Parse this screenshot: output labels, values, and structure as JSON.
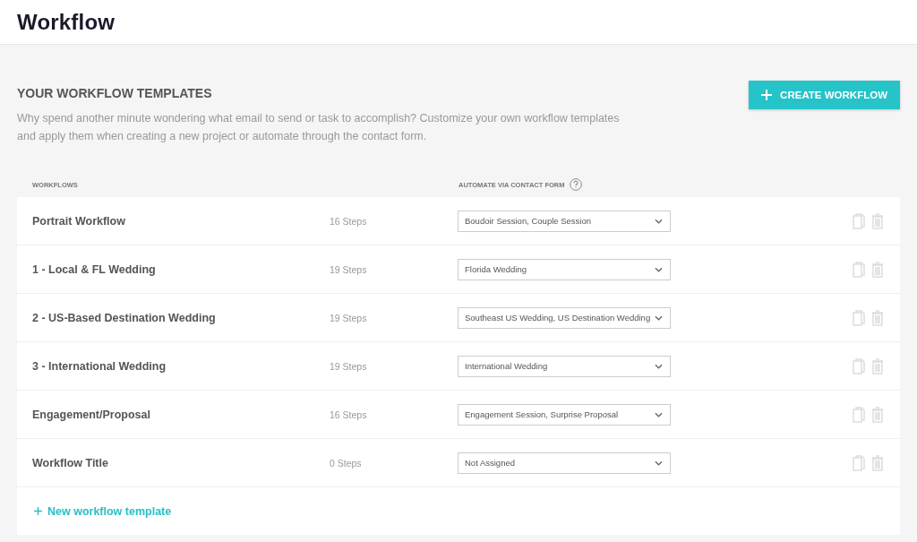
{
  "page_title": "Workflow",
  "section": {
    "heading": "YOUR WORKFLOW TEMPLATES",
    "description": "Why spend another minute wondering what email to send or task to accomplish? Customize your own workflow templates and apply them when creating a new project or automate through the contact form.",
    "create_button": "CREATE WORKFLOW"
  },
  "table": {
    "columns": [
      "WORKFLOWS",
      "AUTOMATE VIA CONTACT FORM"
    ],
    "rows": [
      {
        "name": "Portrait Workflow",
        "steps": "16 Steps",
        "contact_form": "Boudoir Session, Couple Session"
      },
      {
        "name": "1 - Local & FL Wedding",
        "steps": "19 Steps",
        "contact_form": "Florida Wedding"
      },
      {
        "name": "2 - US-Based Destination Wedding",
        "steps": "19 Steps",
        "contact_form": "Southeast US Wedding, US Destination Wedding"
      },
      {
        "name": "3 - International Wedding",
        "steps": "19 Steps",
        "contact_form": "International Wedding"
      },
      {
        "name": "Engagement/Proposal",
        "steps": "16 Steps",
        "contact_form": "Engagement Session, Surprise Proposal"
      },
      {
        "name": "Workflow Title",
        "steps": "0 Steps",
        "contact_form": "Not Assigned"
      }
    ],
    "new_link": "New workflow template"
  }
}
